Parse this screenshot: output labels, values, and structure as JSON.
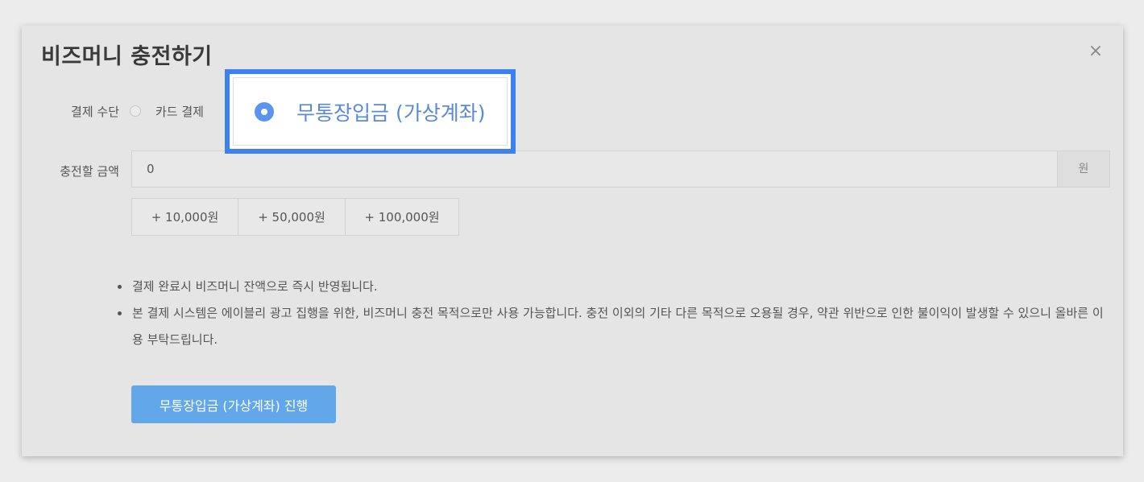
{
  "modal": {
    "title": "비즈머니 충전하기",
    "close_label": "×"
  },
  "payment": {
    "label": "결제 수단",
    "options": [
      {
        "label": "카드 결제",
        "selected": false
      },
      {
        "label": "무통장입금 (가상계좌)",
        "selected": true
      }
    ]
  },
  "amount": {
    "label": "충전할 금액",
    "value": "0",
    "unit": "원",
    "quick_buttons": [
      "+ 10,000원",
      "+ 50,000원",
      "+ 100,000원"
    ]
  },
  "notes": [
    "결제 완료시 비즈머니 잔액으로 즉시 반영됩니다.",
    "본 결제 시스템은 에이블리 광고 집행을 위한, 비즈머니 충전 목적으로만 사용 가능합니다. 충전 이외의 기타 다른 목적으로 오용될 경우, 약관 위반으로 인한 불이익이 발생할 수 있으니 올바른 이용 부탁드립니다."
  ],
  "proceed_button": "무통장입금 (가상계좌) 진행",
  "colors": {
    "accent": "#62a7ea",
    "highlight_border": "#3b82f0",
    "selected_radio": "#5a94ec"
  }
}
